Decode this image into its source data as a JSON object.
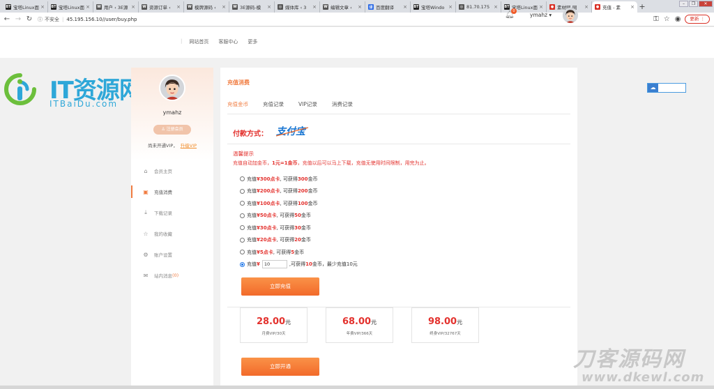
{
  "browser": {
    "tabs": [
      {
        "label": "宝塔Linux面",
        "icon": "bt-icon",
        "fav": "BT",
        "color": "#222"
      },
      {
        "label": "宝塔Linux面",
        "icon": "bt-icon",
        "fav": "BT",
        "color": "#222"
      },
      {
        "label": "用户 ‹ 3E源",
        "icon": "wordpress-icon",
        "fav": "W",
        "color": "#555"
      },
      {
        "label": "资源订单 ‹",
        "icon": "wordpress-icon",
        "fav": "W",
        "color": "#555"
      },
      {
        "label": "模牌源码 ‹",
        "icon": "wordpress-icon",
        "fav": "W",
        "color": "#555"
      },
      {
        "label": "3E源码-模",
        "icon": "wordpress-icon",
        "fav": "W",
        "color": "#555"
      },
      {
        "label": "媒体库 ‹ 3",
        "icon": "globe-icon",
        "fav": "◎",
        "color": "#555"
      },
      {
        "label": "编辑文章 ‹",
        "icon": "wordpress-icon",
        "fav": "W",
        "color": "#555"
      },
      {
        "label": "百度翻译",
        "icon": "translate-icon",
        "fav": "译",
        "color": "#2d6be5"
      },
      {
        "label": "宝塔Windo",
        "icon": "bt-icon",
        "fav": "BT",
        "color": "#222"
      },
      {
        "label": "81.70.175",
        "icon": "globe-icon",
        "fav": "◎",
        "color": "#555"
      },
      {
        "label": "宝塔Linux面",
        "icon": "bt-icon",
        "fav": "BT",
        "color": "#222"
      },
      {
        "label": "素材网-网",
        "icon": "site-icon",
        "fav": "●",
        "color": "#d93025"
      },
      {
        "label": "充值 - 素",
        "icon": "site-icon",
        "fav": "●",
        "color": "#d93025",
        "active": true
      }
    ],
    "new_tab": "+",
    "security_label": "不安全",
    "url": "45.195.156.10//user/buy.php",
    "update_label": "更新"
  },
  "header": {
    "nav": [
      "网站首页",
      "客服中心",
      "更多"
    ],
    "notify_count": "0",
    "username": "ymahz ▾"
  },
  "logo": {
    "text": "IT资源网",
    "sub": "ITBaiDu.com"
  },
  "sidebar": {
    "name": "ymahz",
    "member_btn": "注册会员",
    "vip_status": "尚未开通VIP，",
    "vip_upgrade": "升级VIP",
    "items": [
      {
        "label": "会员主页",
        "icon": "home-icon",
        "glyph": "⌂"
      },
      {
        "label": "充值消费",
        "icon": "wallet-icon",
        "glyph": "▣",
        "active": true
      },
      {
        "label": "下载记录",
        "icon": "download-icon",
        "glyph": "⤓"
      },
      {
        "label": "我的收藏",
        "icon": "star-icon",
        "glyph": "☆"
      },
      {
        "label": "账户设置",
        "icon": "gear-icon",
        "glyph": "⚙"
      },
      {
        "label": "站内消息",
        "icon": "mail-icon",
        "glyph": "✉",
        "count": "(0)"
      }
    ]
  },
  "main": {
    "title": "充值消费",
    "tabs": [
      "充值金币",
      "充值记录",
      "VIP记录",
      "消费记录"
    ],
    "pay_method_label": "付款方式：",
    "pay_logo_text": "支付宝",
    "tips_title": "温馨提示",
    "tips": {
      "a": "充值自动加金币，",
      "b": "1元=1金币",
      "c": "，充值以后可以马上下载，充值无使用时间限制，用完为止。"
    },
    "options": [
      {
        "pre": "充值 ",
        "card": "¥300点卡",
        "mid": ", 可获得 ",
        "coins": "300",
        "post": " 金币"
      },
      {
        "pre": "充值 ",
        "card": "¥200点卡",
        "mid": ", 可获得 ",
        "coins": "200",
        "post": " 金币"
      },
      {
        "pre": "充值 ",
        "card": "¥100点卡",
        "mid": ", 可获得 ",
        "coins": "100",
        "post": " 金币"
      },
      {
        "pre": "充值 ",
        "card": "¥50点卡",
        "mid": ", 可获得 ",
        "coins": "50",
        "post": " 金币"
      },
      {
        "pre": "充值 ",
        "card": "¥30点卡",
        "mid": ", 可获得 ",
        "coins": "30",
        "post": " 金币"
      },
      {
        "pre": "充值 ",
        "card": "¥20点卡",
        "mid": ", 可获得 ",
        "coins": "20",
        "post": " 金币"
      },
      {
        "pre": "充值 ",
        "card": "¥5点卡",
        "mid": ", 可获得 ",
        "coins": "5",
        "post": " 金币"
      }
    ],
    "custom": {
      "pre": "充值 ",
      "currency": "¥",
      "value": "10",
      "mid": " ,可获得 ",
      "coins": "10",
      "post": " 金币，最少充值10元"
    },
    "recharge_btn": "立即充值",
    "vip_plans": [
      {
        "price": "28.00",
        "unit": "元",
        "desc": "月费VIP/30天"
      },
      {
        "price": "68.00",
        "unit": "元",
        "desc": "年费VIP/366天"
      },
      {
        "price": "98.00",
        "unit": "元",
        "desc": "终身VIP/32767天"
      }
    ],
    "open_btn": "立即开通"
  },
  "watermark": {
    "line1": "刀客源码网",
    "line2": "www.dkewl.com"
  },
  "colors": {
    "accent": "#f07b3f",
    "price_red": "#e3312d",
    "logo_blue": "#2ea7d8",
    "logo_green": "#6cbf3c"
  }
}
